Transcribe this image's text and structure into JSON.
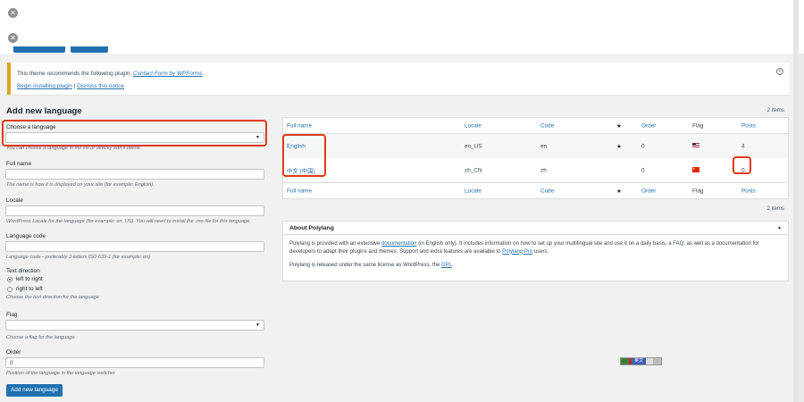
{
  "notice": {
    "text": "This theme recommends the following plugin:",
    "plugin_link": "Contact Form by WPForms",
    "period": ".",
    "install_link": "Begin installing plugin",
    "separator": "|",
    "dismiss_link": "Dismiss this notice"
  },
  "form": {
    "heading": "Add new language",
    "choose_label": "Choose a language",
    "choose_hint": "You can choose a language in the list or directly edit it below.",
    "fullname_label": "Full name",
    "fullname_hint": "The name is how it is displayed on your site (for example: English).",
    "locale_label": "Locale",
    "locale_hint": "WordPress Locale for the language (for example: en_US). You will need to install the .mo file for this language.",
    "code_label": "Language code",
    "code_hint": "Language code - preferably 2-letters ISO 639-1 (for example: en)",
    "direction_label": "Text direction",
    "ltr_label": "left to right",
    "rtl_label": "right to left",
    "direction_hint": "Choose the text direction for the language",
    "flag_label": "Flag",
    "flag_hint": "Choose a flag for the language.",
    "order_label": "Order",
    "order_value": "0",
    "order_hint": "Position of the language in the language switcher",
    "submit_label": "Add new language"
  },
  "table": {
    "count_top": "2 items",
    "count_bottom": "2 items",
    "columns": {
      "name": "Full name",
      "locale": "Locale",
      "code": "Code",
      "default": "★",
      "order": "Order",
      "flag": "Flag",
      "posts": "Posts"
    },
    "rows": [
      {
        "name": "English",
        "locale": "en_US",
        "code": "en",
        "default": "★",
        "order": "0",
        "posts": "4"
      },
      {
        "name": "中文 (中国)",
        "locale": "zh_CN",
        "code": "zh",
        "default": "",
        "order": "0",
        "posts": "0"
      }
    ]
  },
  "about": {
    "title": "About Polylang",
    "caret": "▲",
    "p1_a": "Polylang is provided with an extensive",
    "p1_link1": "documentation",
    "p1_b": "(in English only). It includes information on how to set up your multilingual site and use it on a daily basis, a FAQ, as well as a documentation for developers to adapt their plugins and themes. Support and extra features are available to",
    "p1_link2": "Polylang Pro",
    "p1_c": "users.",
    "p2_a": "Polylang is released under the same license as WordPress, the",
    "p2_link": "GPL",
    "p2_b": "."
  },
  "flagbar": {
    "label": "英文"
  },
  "colors": {
    "accent": "#2271b1",
    "highlight": "#e03a16",
    "warning": "#dba617"
  }
}
